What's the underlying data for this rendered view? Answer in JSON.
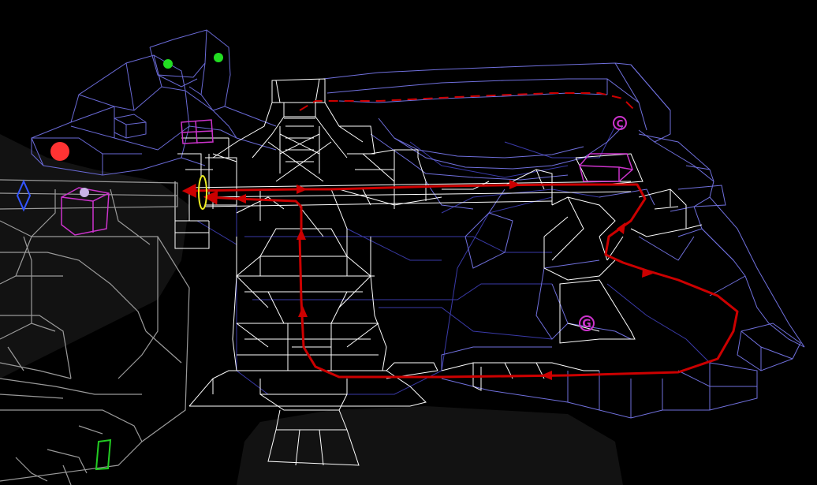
{
  "scene": {
    "background_color": "#000000",
    "shadow_color": "#111111"
  },
  "colors": {
    "level_wire": "#ffffff",
    "far_wire": "#6666d9",
    "deep_wire": "#3a3aa8",
    "player_wire": "#9a9a9a",
    "path": "#cc0000",
    "magenta": "#cc33cc",
    "green_dot": "#22dd22",
    "red_dot": "#ff3333",
    "yellow": "#eeee22",
    "blue_ring": "#3355ff",
    "green_box": "#22cc22",
    "lavender": "#c8b4e6"
  },
  "markers": {
    "goal_label": "G",
    "checkpoint_label": "C"
  },
  "legend": {
    "path_icon": "red-arrow-path",
    "goal_icon": "magenta-g-circle",
    "start_icon": "red-dot"
  }
}
